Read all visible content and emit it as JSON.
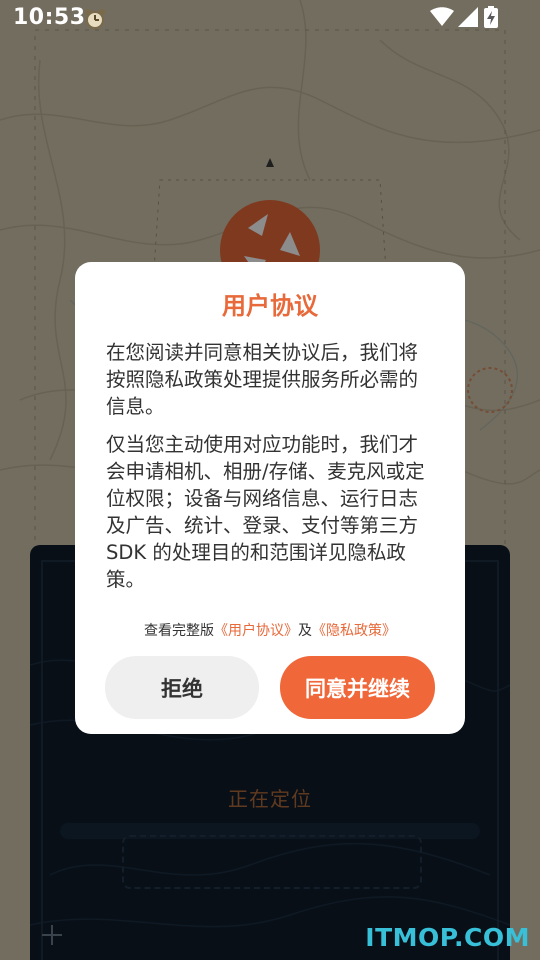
{
  "status_bar": {
    "time": "10:53",
    "icons": [
      "alarm-icon",
      "wifi-icon",
      "signal-icon",
      "battery-icon"
    ]
  },
  "background": {
    "locating_text": "正在定位"
  },
  "dialog": {
    "title": "用户协议",
    "paragraph1": "在您阅读并同意相关协议后，我们将按照隐私政策处理提供服务所必需的信息。",
    "paragraph2": "仅当您主动使用对应功能时，我们才会申请相机、相册/存储、麦克风或定位权限；设备与网络信息、运行日志及广告、统计、登录、支付等第三方 SDK 的处理目的和范围详见隐私政策。",
    "links_prefix": "查看完整版",
    "user_agreement_link": "《用户协议》",
    "links_and": "及",
    "privacy_policy_link": "《隐私政策》",
    "reject_label": "拒绝",
    "agree_label": "同意并继续"
  },
  "watermark": "ITMOP.COM",
  "colors": {
    "accent": "#f0683a",
    "title": "#e8693a",
    "panel": "#0f1c2b",
    "map": "#cfc6ac",
    "watermark": "#38c0d8"
  }
}
